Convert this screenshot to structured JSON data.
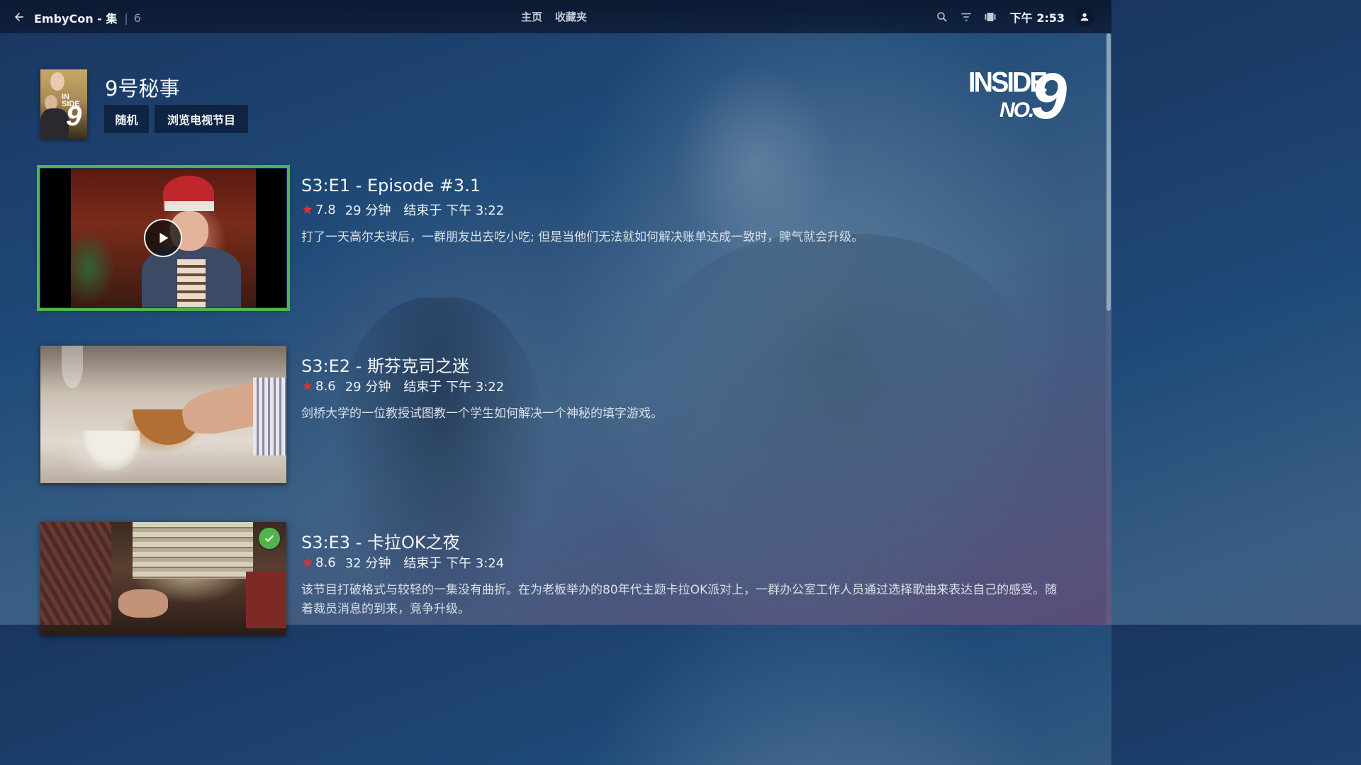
{
  "header": {
    "app_title": "EmbyCon - 集",
    "separator": "|",
    "count": "6",
    "nav": [
      "主页",
      "收藏夹"
    ],
    "time": "下午 2:53"
  },
  "show": {
    "title": "9号秘事",
    "buttons": {
      "shuffle": "随机",
      "browse": "浏览电视节目"
    },
    "poster_text": "INSIDE No.9",
    "logo": {
      "line1": "INSIDE",
      "line2": "NO.",
      "number": "9"
    }
  },
  "episodes": [
    {
      "title": "S3:E1 - Episode #3.1",
      "rating": "7.8",
      "runtime": "29 分钟",
      "ends_at": "结束于 下午 3:22",
      "overview": "打了一天高尔夫球后，一群朋友出去吃小吃; 但是当他们无法就如何解决账单达成一致时，脾气就会升级。",
      "focused": true,
      "watched": false
    },
    {
      "title": "S3:E2 - 斯芬克司之迷",
      "rating": "8.6",
      "runtime": "29 分钟",
      "ends_at": "结束于 下午 3:22",
      "overview": "剑桥大学的一位教授试图教一个学生如何解决一个神秘的填字游戏。",
      "focused": false,
      "watched": false
    },
    {
      "title": "S3:E3 - 卡拉OK之夜",
      "rating": "8.6",
      "runtime": "32 分钟",
      "ends_at": "结束于 下午 3:24",
      "overview": "该节目打破格式与较轻的一集没有曲折。在为老板举办的80年代主题卡拉OK派对上，一群办公室工作人员通过选择歌曲来表达自己的感受。随着裁员消息的到来，竞争升级。",
      "focused": false,
      "watched": true
    }
  ],
  "colors": {
    "accent": "#52b54b",
    "star": "#e03030",
    "button_bg": "#0c1e3a"
  },
  "icons": [
    "back-arrow-icon",
    "search-icon",
    "filter-icon",
    "cast-icon",
    "user-icon",
    "play-icon",
    "check-icon",
    "star-icon"
  ]
}
